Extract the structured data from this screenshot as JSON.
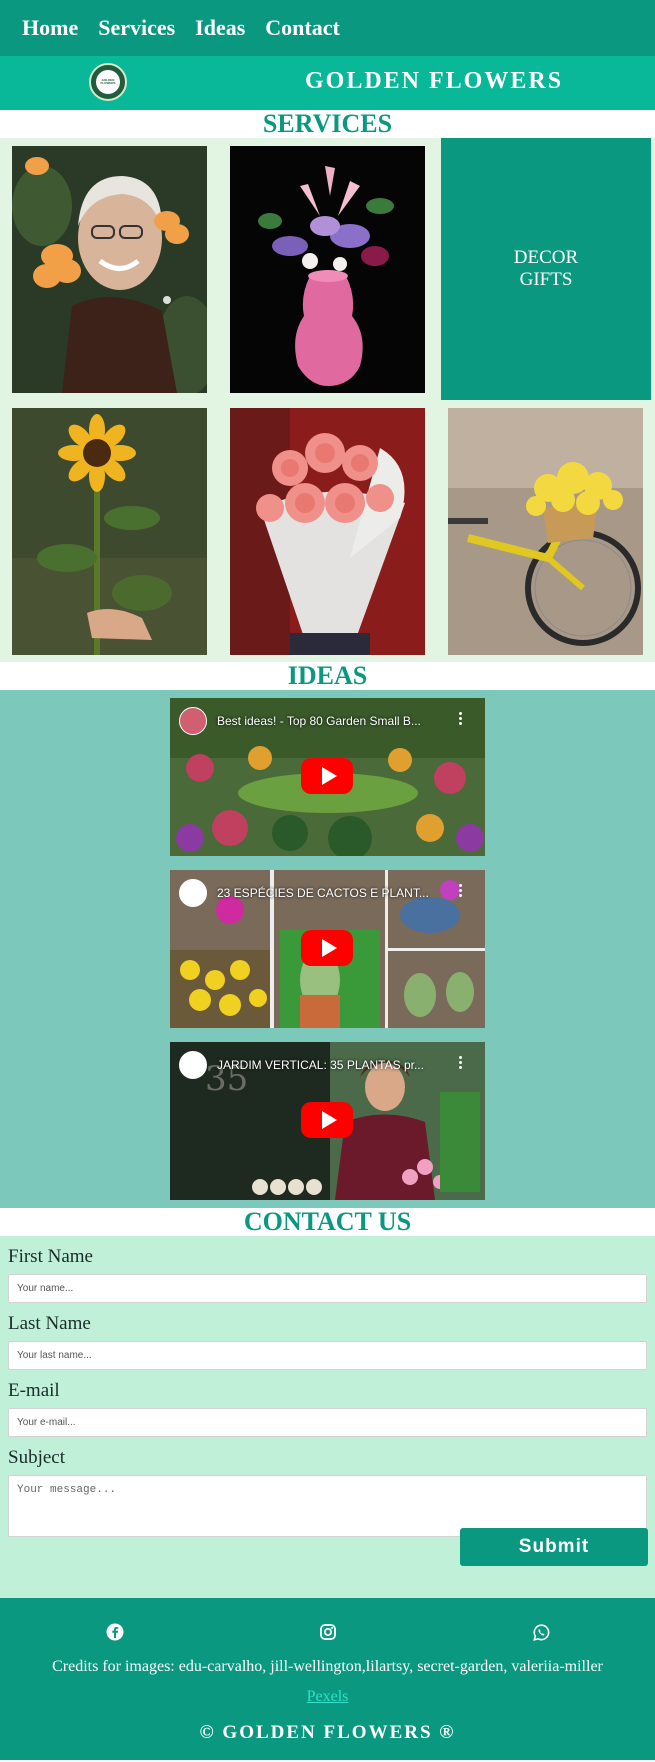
{
  "nav": {
    "items": [
      {
        "label": "Home"
      },
      {
        "label": "Services"
      },
      {
        "label": "Ideas"
      },
      {
        "label": "Contact"
      }
    ]
  },
  "brand": {
    "title": "GOLDEN FLOWERS",
    "logo_text": "GOLDEN FLOWERS"
  },
  "services": {
    "title": "SERVICES",
    "decor_line1": "DECOR",
    "decor_line2": "GIFTS",
    "photos": [
      {
        "name": "smiling-woman-with-flowers-photo"
      },
      {
        "name": "pink-vase-bouquet-photo"
      },
      {
        "name": "sunflower-photo"
      },
      {
        "name": "pink-rose-bouquet-photo"
      },
      {
        "name": "bicycle-flower-basket-photo"
      }
    ]
  },
  "ideas": {
    "title": "IDEAS",
    "videos": [
      {
        "title": "Best ideas! - Top 80 Garden Small B..."
      },
      {
        "title": "23 ESPÉCIES DE CACTOS E PLANT..."
      },
      {
        "title": "JARDIM VERTICAL: 35 PLANTAS pr..."
      }
    ]
  },
  "contact": {
    "title": "CONTACT US",
    "first_name_label": "First Name",
    "first_name_placeholder": "Your name...",
    "last_name_label": "Last Name",
    "last_name_placeholder": "Your last name...",
    "email_label": "E-mail",
    "email_placeholder": "Your e-mail...",
    "subject_label": "Subject",
    "subject_placeholder": "Your message...",
    "submit_label": "Submit"
  },
  "footer": {
    "icons": [
      "facebook-icon",
      "instagram-icon",
      "whatsapp-icon"
    ],
    "credits": "Credits for images: edu-carvalho, jill-wellington,lilartsy, secret-garden, valeriia-miller",
    "link_text": "Pexels",
    "copyright": "© GOLDEN FLOWERS ®"
  },
  "colors": {
    "nav_bg": "#0a9980",
    "brand_bg": "#08b898",
    "services_bg": "#e2f5e2",
    "ideas_bg": "#7cc8bb",
    "contact_bg": "#c0f0d8",
    "accent": "#0a9980"
  }
}
